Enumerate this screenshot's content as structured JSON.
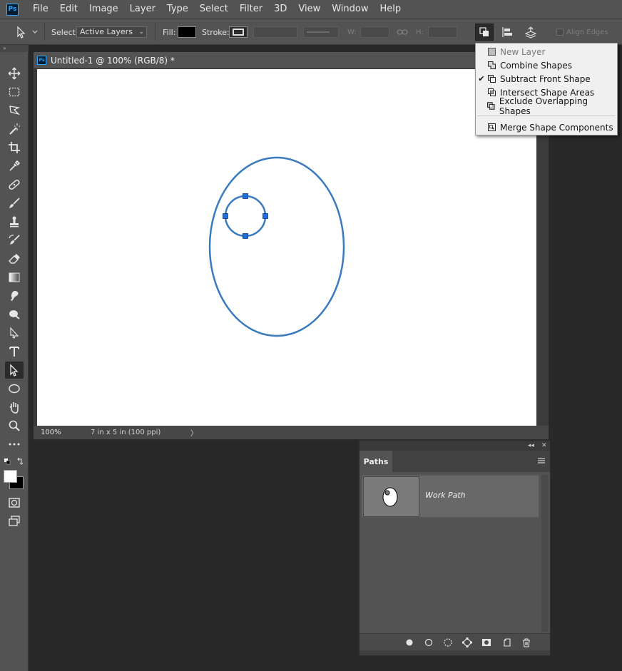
{
  "app": {
    "logo": "Ps"
  },
  "menubar": {
    "items": [
      "File",
      "Edit",
      "Image",
      "Layer",
      "Type",
      "Select",
      "Filter",
      "3D",
      "View",
      "Window",
      "Help"
    ]
  },
  "options_bar": {
    "select_label": "Select:",
    "select_value": "Active Layers",
    "fill_label": "Fill:",
    "stroke_label": "Stroke:",
    "w_label": "W:",
    "h_label": "H:",
    "align_edges_label": "Align Edges",
    "fill_color": "#000000"
  },
  "path_operations_menu": {
    "items": [
      {
        "label": "New Layer",
        "checked": false,
        "disabled": true,
        "icon": "new-layer-icon"
      },
      {
        "label": "Combine Shapes",
        "checked": false,
        "disabled": false,
        "icon": "combine-shapes-icon"
      },
      {
        "label": "Subtract Front Shape",
        "checked": true,
        "disabled": false,
        "icon": "subtract-front-shape-icon"
      },
      {
        "label": "Intersect Shape Areas",
        "checked": false,
        "disabled": false,
        "icon": "intersect-shape-areas-icon"
      },
      {
        "label": "Exclude Overlapping Shapes",
        "checked": false,
        "disabled": false,
        "icon": "exclude-overlapping-shapes-icon"
      },
      {
        "label": "Merge Shape Components",
        "checked": false,
        "disabled": false,
        "icon": "merge-shape-components-icon"
      }
    ],
    "check_glyph": "✔"
  },
  "document": {
    "title": "Untitled-1 @ 100% (RGB/8) *",
    "zoom": "100%",
    "info": "7 in x 5 in (100 ppi)",
    "info_arrow": "〉",
    "path_color": "#3a7bbf",
    "anchor_color": "#1e6fd9"
  },
  "paths_panel": {
    "collapse_glyph": "◂◂",
    "close_glyph": "✕",
    "tab_label": "Paths",
    "path_name": "Work Path"
  },
  "toolbar": {
    "tools": [
      "move-tool-icon",
      "marquee-tool-icon",
      "lasso-tool-icon",
      "magic-wand-tool-icon",
      "crop-tool-icon",
      "eyedropper-tool-icon",
      "healing-brush-tool-icon",
      "brush-tool-icon",
      "clone-stamp-tool-icon",
      "history-brush-tool-icon",
      "eraser-tool-icon",
      "gradient-tool-icon",
      "blur-tool-icon",
      "dodge-tool-icon",
      "pen-tool-icon",
      "type-tool-icon",
      "path-selection-tool-icon",
      "ellipse-tool-icon",
      "hand-tool-icon",
      "zoom-tool-icon",
      "more-tools-icon"
    ],
    "active_tool": "path-selection-tool-icon",
    "foreground_color": "#ffffff",
    "background_color": "#000000"
  }
}
